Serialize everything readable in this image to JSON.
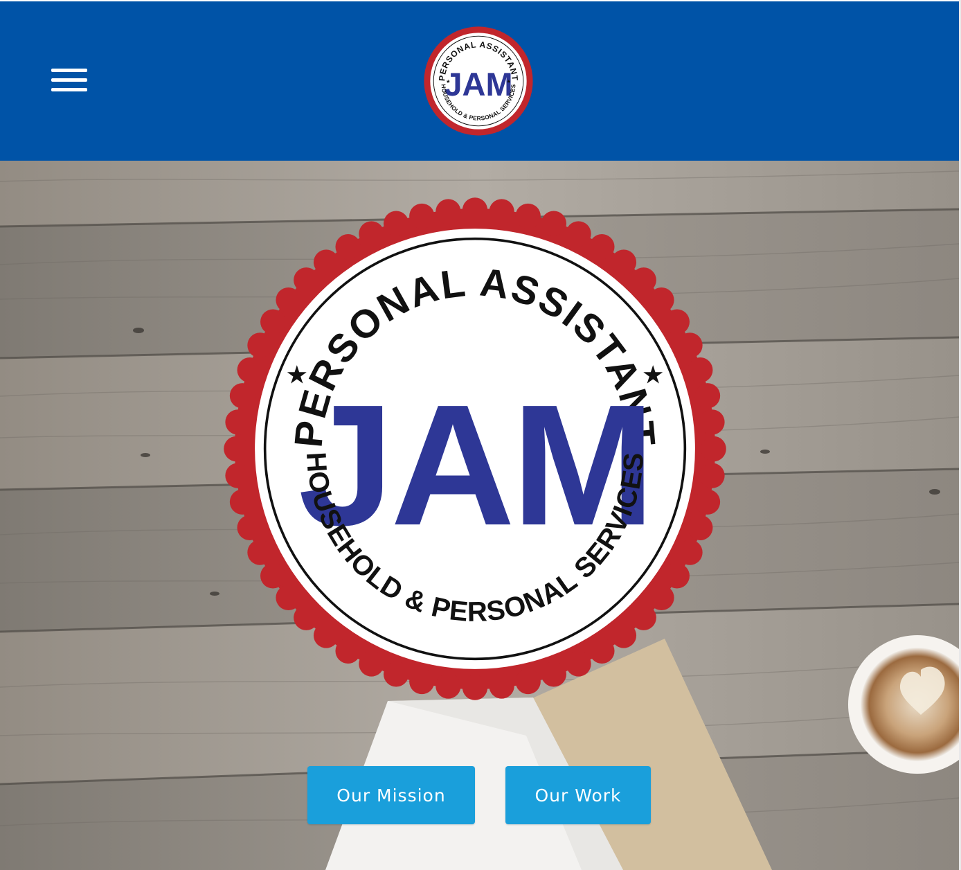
{
  "header": {
    "menu_icon": "hamburger-menu-icon",
    "background_color": "#0053a7",
    "logo": {
      "top_text": "PERSONAL ASSISTANT",
      "center_text": "JAM",
      "bottom_text": "HOUSEHOLD & PERSONAL SERVICES"
    }
  },
  "hero": {
    "logo": {
      "top_text": "PERSONAL ASSISTANT",
      "center_text": "JAM",
      "bottom_text": "HOUSEHOLD & PERSONAL SERVICES"
    },
    "buttons": {
      "mission_label": "Our Mission",
      "work_label": "Our Work"
    },
    "button_color": "#1a9fdb"
  },
  "colors": {
    "seal_red": "#c1262c",
    "jam_blue": "#2e3796",
    "wood": "#8a8680"
  }
}
